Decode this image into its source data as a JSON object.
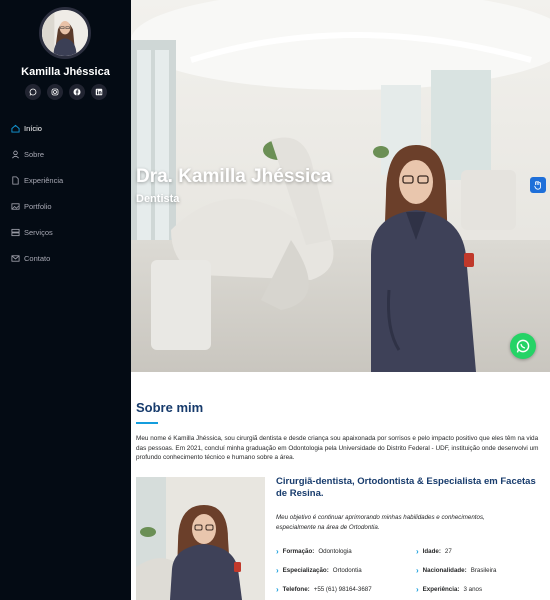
{
  "profile": {
    "name": "Kamilla Jhéssica"
  },
  "social": [
    {
      "icon": "whatsapp-icon"
    },
    {
      "icon": "instagram-icon"
    },
    {
      "icon": "facebook-icon"
    },
    {
      "icon": "linkedin-icon"
    }
  ],
  "nav": [
    {
      "label": "Início",
      "icon": "home-icon",
      "active": true
    },
    {
      "label": "Sobre",
      "icon": "person-icon"
    },
    {
      "label": "Experiência",
      "icon": "file-icon"
    },
    {
      "label": "Portfolio",
      "icon": "images-icon"
    },
    {
      "label": "Serviços",
      "icon": "server-icon"
    },
    {
      "label": "Contato",
      "icon": "envelope-icon"
    }
  ],
  "hero": {
    "title": "Dra. Kamilla Jhéssica",
    "subtitle": "Dentista"
  },
  "about": {
    "title": "Sobre mim",
    "text": "Meu nome é Kamilla Jhéssica, sou cirurgiã dentista e desde criança sou apaixonada por sorrisos e pelo impacto positivo que eles têm na vida das pessoas. Em 2021, concluí minha graduação em Odontologia pela Universidade do Distrito Federal - UDF, instituição onde desenvolvi um profundo conhecimento técnico e humano sobre a área.",
    "spec_title": "Cirurgiã-dentista, Ortodontista & Especialista em Facetas de Resina.",
    "objective": "Meu objetivo é continuar aprimorando minhas habilidades e conhecimentos, especialmente na área de Ortodontia.",
    "info": {
      "formacao_label": "Formação:",
      "formacao_value": "Odontologia",
      "idade_label": "Idade:",
      "idade_value": "27",
      "especializacao_label": "Especialização:",
      "especializacao_value": "Ortodontia",
      "nacionalidade_label": "Nacionalidade:",
      "nacionalidade_value": "Brasileira",
      "telefone_label": "Telefone:",
      "telefone_value": "+55 (61) 98164-3687",
      "experiencia_label": "Experiência:",
      "experiencia_value": "3 anos"
    }
  },
  "colors": {
    "sidebar": "#040b14",
    "accent": "#149ddd",
    "heading": "#173b6c",
    "whatsapp": "#25d366"
  }
}
